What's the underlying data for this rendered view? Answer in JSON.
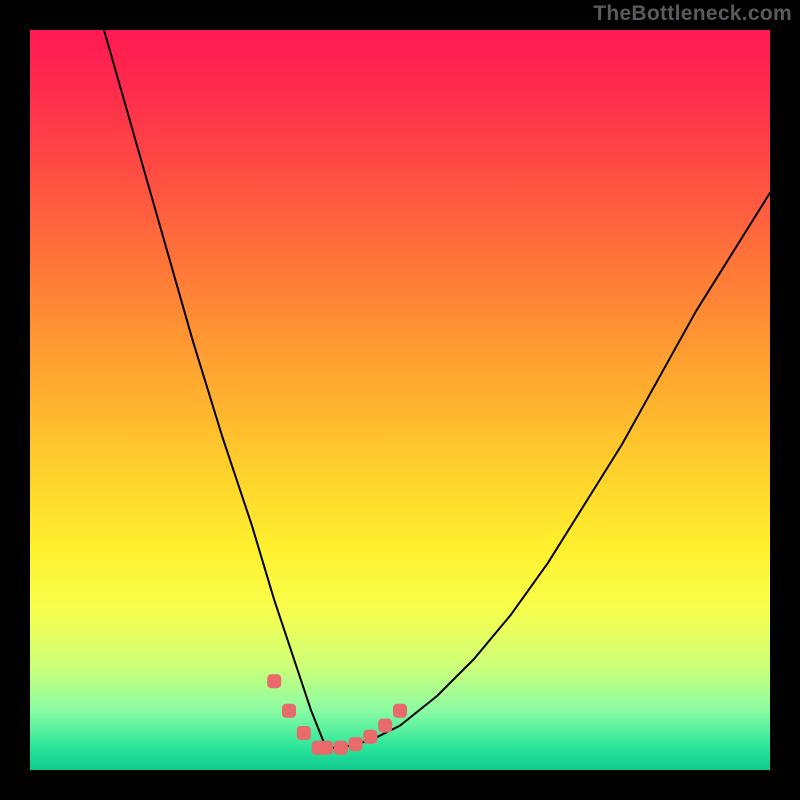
{
  "watermark": "TheBottleneck.com",
  "chart_data": {
    "type": "line",
    "title": "",
    "xlabel": "",
    "ylabel": "",
    "xlim": [
      0,
      100
    ],
    "ylim": [
      0,
      100
    ],
    "grid": false,
    "legend": false,
    "series": [
      {
        "name": "bottleneck-curve",
        "x": [
          10,
          14,
          18,
          22,
          26,
          30,
          33,
          36,
          38,
          40,
          42,
          46,
          50,
          55,
          60,
          65,
          70,
          75,
          80,
          85,
          90,
          95,
          100
        ],
        "values": [
          100,
          86,
          72,
          58,
          45,
          33,
          23,
          14,
          8,
          3,
          3,
          4,
          6,
          10,
          15,
          21,
          28,
          36,
          44,
          53,
          62,
          70,
          78
        ]
      }
    ],
    "markers": {
      "name": "highlight-points",
      "color": "#e86a6a",
      "x": [
        33,
        35,
        37,
        39,
        40,
        42,
        44,
        46,
        48,
        50
      ],
      "values": [
        12,
        8,
        5,
        3,
        3,
        3,
        3.5,
        4.5,
        6,
        8
      ]
    },
    "gradient_stops": [
      {
        "pos": 0.0,
        "color": "#ff1a53"
      },
      {
        "pos": 0.18,
        "color": "#ff4944"
      },
      {
        "pos": 0.38,
        "color": "#ff8a34"
      },
      {
        "pos": 0.6,
        "color": "#ffd22c"
      },
      {
        "pos": 0.78,
        "color": "#f9ff4b"
      },
      {
        "pos": 0.92,
        "color": "#8afca3"
      },
      {
        "pos": 1.0,
        "color": "#10c98f"
      }
    ]
  }
}
